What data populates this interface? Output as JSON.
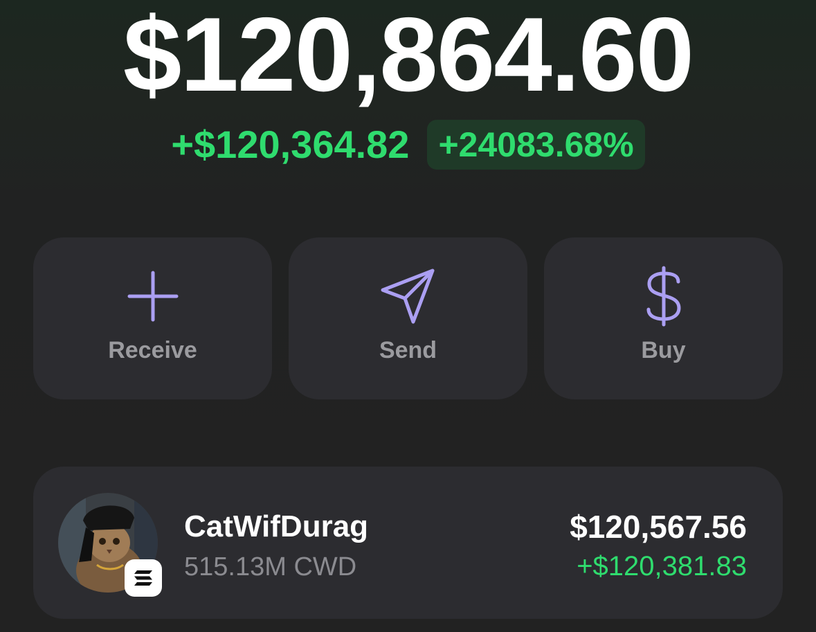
{
  "portfolio": {
    "balance": "$120,864.60",
    "change_amount": "+$120,364.82",
    "change_percent": "+24083.68%"
  },
  "actions": [
    {
      "label": "Receive",
      "icon": "plus-icon"
    },
    {
      "label": "Send",
      "icon": "send-paper-plane-icon"
    },
    {
      "label": "Buy",
      "icon": "dollar-icon"
    }
  ],
  "tokens": [
    {
      "name": "CatWifDurag",
      "amount": "515.13M CWD",
      "value": "$120,567.56",
      "change": "+$120,381.83",
      "avatar": "cat-avatar",
      "chain_icon": "solana-icon"
    }
  ],
  "colors": {
    "positive": "#2fdc6e",
    "accent_icon": "#ab9ff2",
    "card_bg": "#2c2c30",
    "muted_text": "#9b9b9f"
  }
}
